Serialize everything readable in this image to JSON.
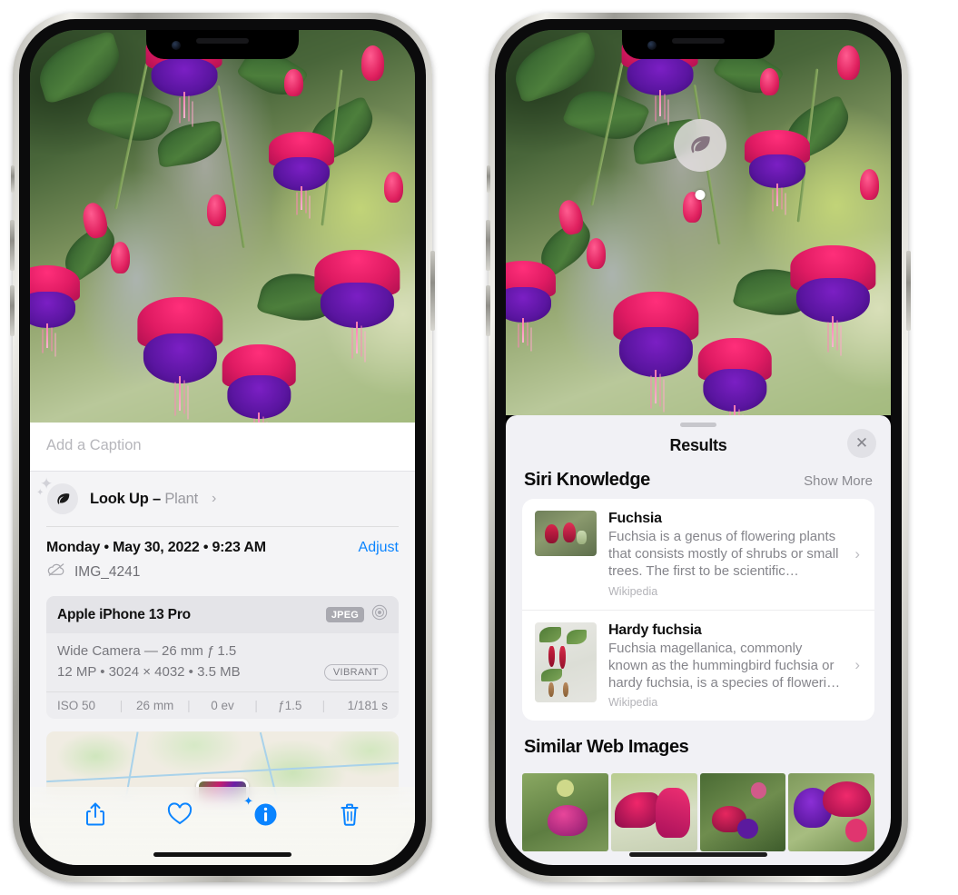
{
  "left_phone": {
    "caption_placeholder": "Add a Caption",
    "lookup": {
      "icon": "leaf-icon",
      "label": "Look Up – ",
      "subject": "Plant",
      "chevron": "›"
    },
    "date_line": "Monday • May 30, 2022 • 9:23 AM",
    "adjust_label": "Adjust",
    "filename": "IMG_4241",
    "filename_icon": "cloud-slash-icon",
    "exif": {
      "device": "Apple iPhone 13 Pro",
      "format_badge": "JPEG",
      "aperture_icon": "aperture-icon",
      "lens_line": "Wide Camera — 26 mm ƒ 1.5",
      "size_line": "12 MP • 3024 × 4032 • 3.5 MB",
      "vibrant_badge": "VIBRANT",
      "settings": [
        "ISO 50",
        "26 mm",
        "0 ev",
        "ƒ1.5",
        "1/181 s"
      ]
    },
    "toolbar": [
      {
        "name": "share-icon",
        "label": "Share"
      },
      {
        "name": "heart-icon",
        "label": "Favorite"
      },
      {
        "name": "info-live-text-icon",
        "label": "Info"
      },
      {
        "name": "trash-icon",
        "label": "Delete"
      }
    ]
  },
  "right_phone": {
    "badge_icon": "leaf-icon",
    "results_title": "Results",
    "close_icon": "close-icon",
    "siri_section": {
      "title": "Siri Knowledge",
      "action": "Show More",
      "items": [
        {
          "title": "Fuchsia",
          "description": "Fuchsia is a genus of flowering plants that consists mostly of shrubs or small trees. The first to be scientific…",
          "source": "Wikipedia",
          "chevron": "›"
        },
        {
          "title": "Hardy fuchsia",
          "description": "Fuchsia magellanica, commonly known as the hummingbird fuchsia or hardy fuchsia, is a species of floweri…",
          "source": "Wikipedia",
          "chevron": "›"
        }
      ]
    },
    "web_section": {
      "title": "Similar Web Images",
      "count": 4
    }
  },
  "colors": {
    "accent_blue": "#0a84ff",
    "sheet_bg": "#f1f1f5",
    "card_bg": "#ffffff",
    "secondary_text": "#85858b"
  }
}
